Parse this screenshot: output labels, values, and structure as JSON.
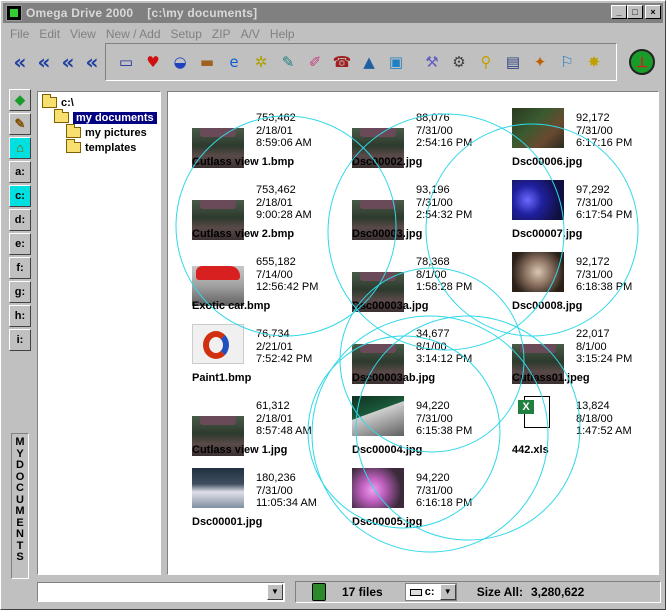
{
  "window": {
    "app_name": "Omega Drive 2000",
    "path": "[c:\\my documents]",
    "min_label": "_",
    "max_label": "□",
    "close_label": "×"
  },
  "menu": [
    "File",
    "Edit",
    "View",
    "New / Add",
    "Setup",
    "ZIP",
    "A/V",
    "Help"
  ],
  "nav_arrows": [
    "«",
    "«",
    "«",
    "«"
  ],
  "toolbar_icons": [
    {
      "name": "exe-icon",
      "glyph": "▭",
      "color": "#2030a0"
    },
    {
      "name": "heart-icon",
      "glyph": "♥",
      "color": "#d01010"
    },
    {
      "name": "disk-icon",
      "glyph": "◒",
      "color": "#2040c0"
    },
    {
      "name": "scanner-icon",
      "glyph": "▬",
      "color": "#a06020"
    },
    {
      "name": "browser-icon",
      "glyph": "e",
      "color": "#1060d0"
    },
    {
      "name": "star-icon",
      "glyph": "✲",
      "color": "#b0a000"
    },
    {
      "name": "note-icon",
      "glyph": "✎",
      "color": "#208080"
    },
    {
      "name": "paint-icon",
      "glyph": "✐",
      "color": "#c04080"
    },
    {
      "name": "phone-icon",
      "glyph": "☎",
      "color": "#a02020"
    },
    {
      "name": "acrobat-icon",
      "glyph": "▲",
      "color": "#2060a0"
    },
    {
      "name": "network-icon",
      "glyph": "▣",
      "color": "#2080c0"
    },
    {
      "name": "tools-icon",
      "glyph": "⚒",
      "color": "#6060c0"
    },
    {
      "name": "gear-icon",
      "glyph": "⚙",
      "color": "#404040"
    },
    {
      "name": "search-icon",
      "glyph": "⚲",
      "color": "#c0a000"
    },
    {
      "name": "computer-icon",
      "glyph": "▤",
      "color": "#304080"
    },
    {
      "name": "wizard-icon",
      "glyph": "✦",
      "color": "#c06000"
    },
    {
      "name": "globe-icon",
      "glyph": "⚐",
      "color": "#2080c0"
    },
    {
      "name": "sparkle-icon",
      "glyph": "✸",
      "color": "#c0a000"
    }
  ],
  "drives": [
    "a:",
    "c:",
    "d:",
    "e:",
    "f:",
    "g:",
    "h:",
    "i:"
  ],
  "active_drive": "c:",
  "mydocs_label": [
    "M",
    "Y",
    "D",
    "O",
    "C",
    "U",
    "M",
    "E",
    "N",
    "T",
    "S"
  ],
  "tree": [
    {
      "label": "c:\\",
      "indent": 0,
      "selected": false
    },
    {
      "label": "my documents",
      "indent": 1,
      "selected": true
    },
    {
      "label": "my pictures",
      "indent": 2,
      "selected": false
    },
    {
      "label": "templates",
      "indent": 2,
      "selected": false
    }
  ],
  "files": [
    {
      "name": "Cutlass view 1.bmp",
      "size": "753,462",
      "date": "2/18/01",
      "time": "8:59:06 AM",
      "thumb": "car-dark"
    },
    {
      "name": "Dsc00002.jpg",
      "size": "88,076",
      "date": "7/31/00",
      "time": "2:54:16 PM",
      "thumb": "car-dark"
    },
    {
      "name": "Dsc00006.jpg",
      "size": "92,172",
      "date": "7/31/00",
      "time": "6:17:16 PM",
      "thumb": "garden"
    },
    {
      "name": "Cutlass view 2.bmp",
      "size": "753,462",
      "date": "2/18/01",
      "time": "9:00:28 AM",
      "thumb": "car-dark"
    },
    {
      "name": "Dsc00003.jpg",
      "size": "93,196",
      "date": "7/31/00",
      "time": "2:54:32 PM",
      "thumb": "car-dark"
    },
    {
      "name": "Dsc00007.jpg",
      "size": "97,292",
      "date": "7/31/00",
      "time": "6:17:54 PM",
      "thumb": "blue"
    },
    {
      "name": "Exotic car.bmp",
      "size": "655,182",
      "date": "7/14/00",
      "time": "12:56:42 PM",
      "thumb": "red-car"
    },
    {
      "name": "Dsc00003a.jpg",
      "size": "78,368",
      "date": "8/1/00",
      "time": "1:58:28 PM",
      "thumb": "car-dark"
    },
    {
      "name": "Dsc00008.jpg",
      "size": "92,172",
      "date": "7/31/00",
      "time": "6:18:38 PM",
      "thumb": "cat"
    },
    {
      "name": "Paint1.bmp",
      "size": "76,734",
      "date": "2/21/01",
      "time": "7:52:42 PM",
      "thumb": "paint"
    },
    {
      "name": "Dsc00003ab.jpg",
      "size": "34,677",
      "date": "8/1/00",
      "time": "3:14:12 PM",
      "thumb": "car-dark"
    },
    {
      "name": "Cutlass01.jpeg",
      "size": "22,017",
      "date": "8/1/00",
      "time": "3:15:24 PM",
      "thumb": "car-dark"
    },
    {
      "name": "Cutlass view 1.jpg",
      "size": "61,312",
      "date": "2/18/01",
      "time": "8:57:48 AM",
      "thumb": "car-dark"
    },
    {
      "name": "Dsc00004.jpg",
      "size": "94,220",
      "date": "7/31/00",
      "time": "6:15:38 PM",
      "thumb": "green-room"
    },
    {
      "name": "442.xls",
      "size": "13,824",
      "date": "8/18/00",
      "time": "1:47:52 AM",
      "thumb": "xls"
    },
    {
      "name": "Dsc00001.jpg",
      "size": "180,236",
      "date": "7/31/00",
      "time": "11:05:34 AM",
      "thumb": "desk"
    },
    {
      "name": "Dsc00005.jpg",
      "size": "94,220",
      "date": "7/31/00",
      "time": "6:16:18 PM",
      "thumb": "pink"
    }
  ],
  "status": {
    "file_count": "17 files",
    "drive": "c:",
    "size_label": "Size All:",
    "size_value": "3,280,622"
  }
}
